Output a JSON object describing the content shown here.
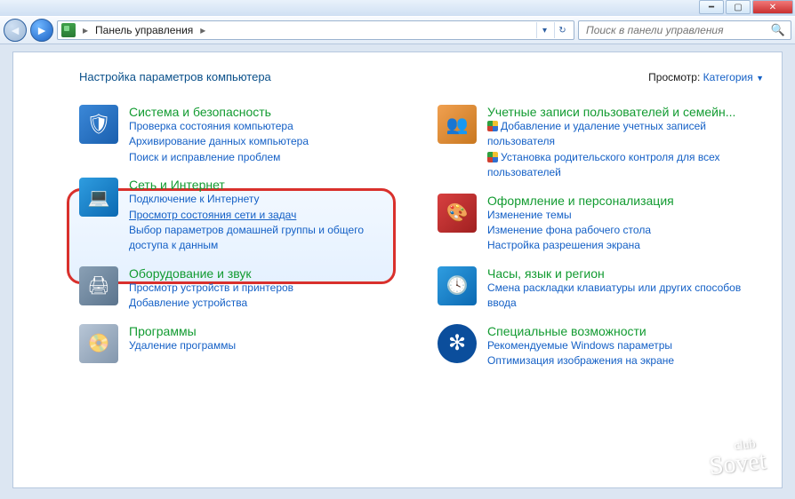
{
  "window": {
    "breadcrumb": "Панель управления"
  },
  "search": {
    "placeholder": "Поиск в панели управления"
  },
  "header": {
    "title": "Настройка параметров компьютера",
    "view_label": "Просмотр:",
    "view_value": "Категория"
  },
  "left": [
    {
      "title": "Система и безопасность",
      "links": [
        "Проверка состояния компьютера",
        "Архивирование данных компьютера",
        "Поиск и исправление проблем"
      ]
    },
    {
      "title": "Сеть и Интернет",
      "links": [
        "Подключение к Интернету",
        "Просмотр состояния сети и задач",
        "Выбор параметров домашней группы и общего доступа к данным"
      ]
    },
    {
      "title": "Оборудование и звук",
      "links": [
        "Просмотр устройств и принтеров",
        "Добавление устройства"
      ]
    },
    {
      "title": "Программы",
      "links": [
        "Удаление программы"
      ]
    }
  ],
  "right": [
    {
      "title": "Учетные записи пользователей и семейн...",
      "shield_links": [
        "Добавление и удаление учетных записей пользователя",
        "Установка родительского контроля для всех пользователей"
      ]
    },
    {
      "title": "Оформление и персонализация",
      "links": [
        "Изменение темы",
        "Изменение фона рабочего стола",
        "Настройка разрешения экрана"
      ]
    },
    {
      "title": "Часы, язык и регион",
      "links": [
        "Смена раскладки клавиатуры или других способов ввода"
      ]
    },
    {
      "title": "Специальные возможности",
      "links": [
        "Рекомендуемые Windows параметры",
        "Оптимизация изображения на экране"
      ]
    }
  ],
  "watermark": {
    "top": "club",
    "main": "Sovet"
  }
}
